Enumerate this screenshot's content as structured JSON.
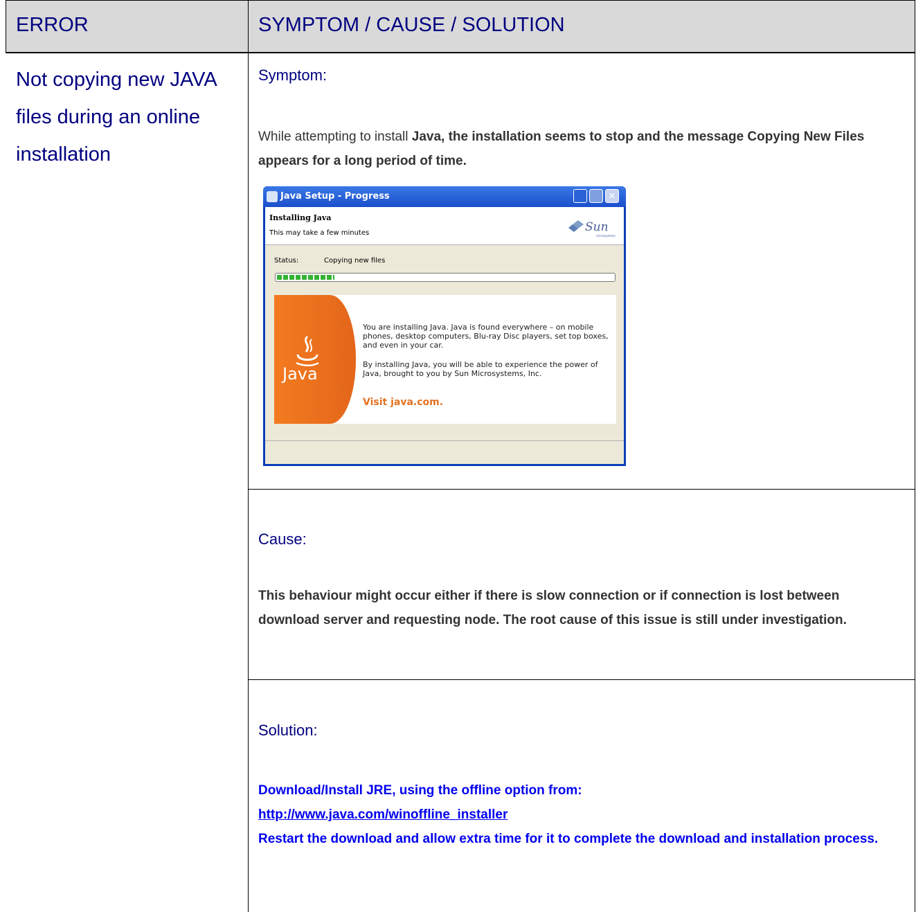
{
  "table": {
    "header": {
      "col1": "ERROR",
      "col2": "SYMPTOM / CAUSE / SOLUTION"
    },
    "error": "Not copying new JAVA files during an online installation",
    "symptom": {
      "label": "Symptom:",
      "text_before": "While attempting to install ",
      "text_bold": "Java, the installation seems to stop and the message Copying New Files appears for a long period of time."
    },
    "cause": {
      "label": "Cause:",
      "text": "This behaviour might occur either if there is slow connection or if connection is lost between download server and requesting node. The root cause of this issue is still under investigation."
    },
    "solution": {
      "label": "Solution:",
      "line1": "Download/Install JRE, using the offline option from:",
      "link": "http://www.java.com/winoffline_installer",
      "line2": "Restart the download and allow extra time for it to complete the download and installation process."
    }
  },
  "java_window": {
    "title": "Java Setup - Progress",
    "close_glyph": "✕",
    "heading": "Installing Java",
    "subheading": "This may take a few minutes",
    "sun_logo": "Sun",
    "sun_logo_sub": "microsystems",
    "status_label": "Status:",
    "status_value": "Copying new files",
    "progress": 0.17,
    "promo_line1": "You are installing Java. Java is found everywhere – on mobile phones, desktop computers, Blu-ray Disc players, set top boxes, and even in your car.",
    "promo_line2": "By installing Java, you will be able to experience the power of Java, brought to you by Sun Microsystems, Inc.",
    "java_logo_text": "Java",
    "visit": "Visit java.com.",
    "colors": {
      "orange": "#f47b20",
      "progress_green": "#33b233",
      "titlebar": "#1a4fcc"
    }
  }
}
